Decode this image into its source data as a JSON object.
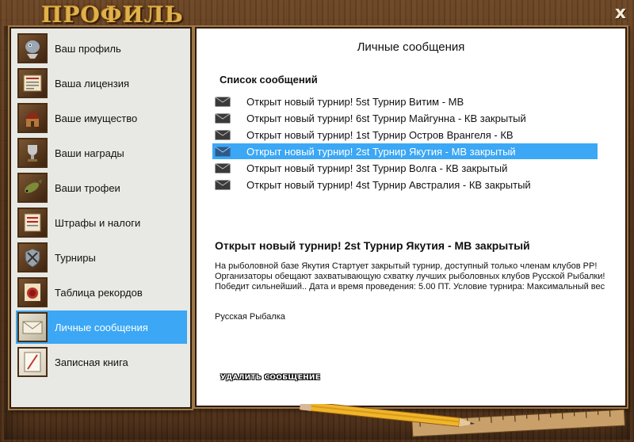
{
  "window": {
    "title": "ПРОФИЛЬ",
    "close_label": "x"
  },
  "sidebar": {
    "items": [
      {
        "label": "Ваш профиль",
        "icon": "profile-fish-icon"
      },
      {
        "label": "Ваша лицензия",
        "icon": "license-icon"
      },
      {
        "label": "Ваше имущество",
        "icon": "property-icon"
      },
      {
        "label": "Ваши награды",
        "icon": "award-icon"
      },
      {
        "label": "Ваши трофеи",
        "icon": "trophy-fish-icon"
      },
      {
        "label": "Штрафы и налоги",
        "icon": "fine-paper-icon"
      },
      {
        "label": "Турниры",
        "icon": "tournament-shield-icon"
      },
      {
        "label": "Таблица рекордов",
        "icon": "records-seal-icon"
      },
      {
        "label": "Личные сообщения",
        "icon": "envelope-icon",
        "active": true
      },
      {
        "label": "Записная книга",
        "icon": "notebook-pencil-icon"
      }
    ]
  },
  "messages": {
    "panel_title": "Личные сообщения",
    "list_heading": "Список сообщений",
    "items": [
      {
        "text": "Открыт новый турнир! 5st Турнир Витим - МВ"
      },
      {
        "text": "Открыт новый турнир! 6st Турнир Майгунна - КВ закрытый"
      },
      {
        "text": "Открыт новый турнир! 1st Турнир Остров Врангеля - КВ"
      },
      {
        "text": "Открыт новый турнир! 2st Турнир Якутия - МВ закрытый",
        "selected": true
      },
      {
        "text": "Открыт новый турнир! 3st Турнир Волга - КВ закрытый"
      },
      {
        "text": "Открыт новый турнир! 4st Турнир Австралия - КВ закрытый"
      }
    ],
    "selected": {
      "title": "Открыт новый турнир! 2st Турнир Якутия - МВ закрытый",
      "body": "На рыболовной базе Якутия Стартует закрытый турнир, доступный только членам клубов РР! Организаторы обещают захватывающую схватку лучших рыболовных клубов Русской Рыбалки! Победит сильнейший.. Дата и время проведения: 5.00 ПТ. Условие турнира: Максимальный вес",
      "signature": "Русская Рыбалка"
    },
    "delete_button": "УДАЛИТЬ СООБЩЕНИЕ"
  },
  "colors": {
    "selection": "#3ba7f5",
    "title_gold": "#e0b04a",
    "wood": "#5a371b"
  }
}
